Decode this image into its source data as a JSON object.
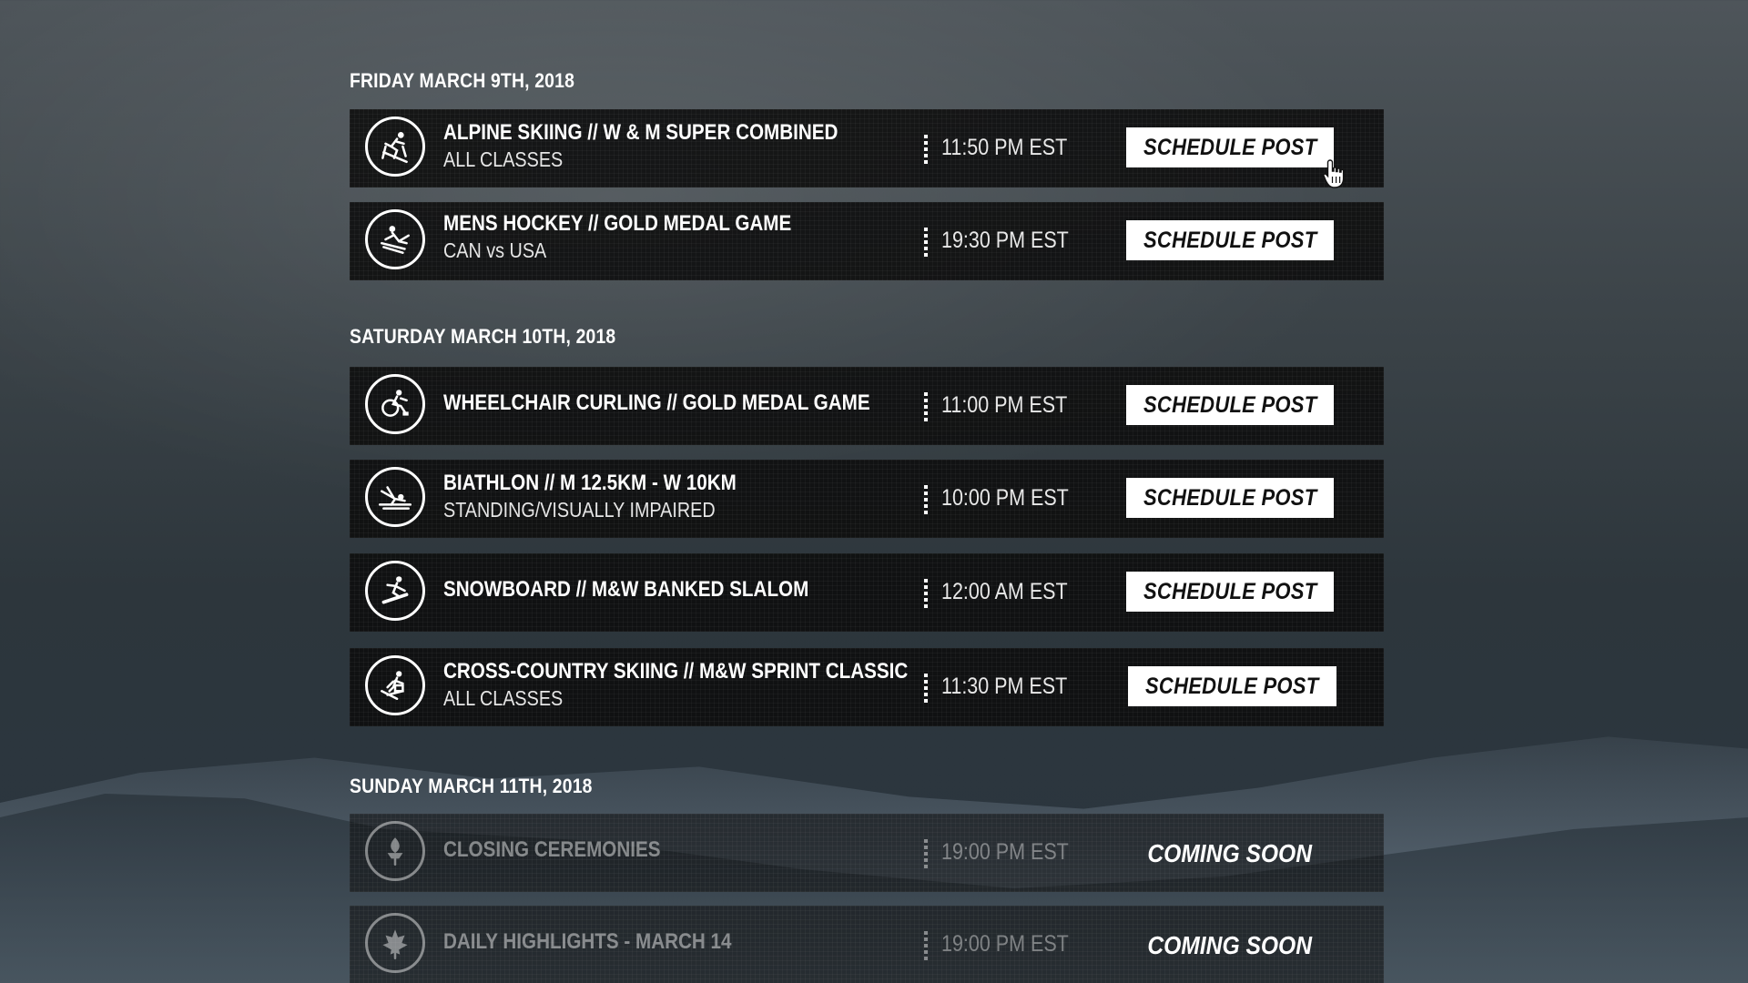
{
  "days": [
    {
      "heading": "FRIDAY MARCH 9TH, 2018",
      "events": [
        {
          "title": "ALPINE SKIING // W & M SUPER COMBINED",
          "subtitle": "ALL CLASSES",
          "time": "11:50 PM EST",
          "action": "SCHEDULE POST",
          "icon": "alpine-skiing-icon"
        },
        {
          "title": "MENS HOCKEY // GOLD MEDAL GAME",
          "subtitle": "CAN vs USA",
          "time": "19:30 PM EST",
          "action": "SCHEDULE POST",
          "icon": "sledge-hockey-icon"
        }
      ]
    },
    {
      "heading": "SATURDAY MARCH 10TH, 2018",
      "events": [
        {
          "title": "WHEELCHAIR CURLING // GOLD MEDAL GAME",
          "subtitle": "",
          "time": "11:00 PM EST",
          "action": "SCHEDULE POST",
          "icon": "wheelchair-curling-icon"
        },
        {
          "title": "BIATHLON // M 12.5KM - W 10KM",
          "subtitle": "STANDING/VISUALLY IMPAIRED",
          "time": "10:00 PM EST",
          "action": "SCHEDULE POST",
          "icon": "biathlon-icon"
        },
        {
          "title": "SNOWBOARD // M&W BANKED SLALOM",
          "subtitle": "",
          "time": "12:00 AM EST",
          "action": "SCHEDULE POST",
          "icon": "snowboard-icon"
        },
        {
          "title": "CROSS-COUNTRY SKIING // M&W SPRINT CLASSIC",
          "subtitle": "ALL CLASSES",
          "time": "11:30 PM EST",
          "action": "SCHEDULE POST",
          "icon": "cross-country-skiing-icon"
        }
      ]
    },
    {
      "heading": "SUNDAY MARCH 11TH, 2018",
      "events": [
        {
          "title": "CLOSING CEREMONIES",
          "subtitle": "",
          "time": "19:00 PM EST",
          "action": "COMING SOON",
          "icon": "torch-icon"
        },
        {
          "title": "DAILY HIGHLIGHTS - MARCH 14",
          "subtitle": "",
          "time": "19:00 PM EST",
          "action": "COMING SOON",
          "icon": "maple-leaf-icon"
        }
      ]
    }
  ],
  "colors": {
    "row_bg": "#0c0c0c",
    "button_bg": "#ffffff",
    "button_text": "#111111"
  }
}
